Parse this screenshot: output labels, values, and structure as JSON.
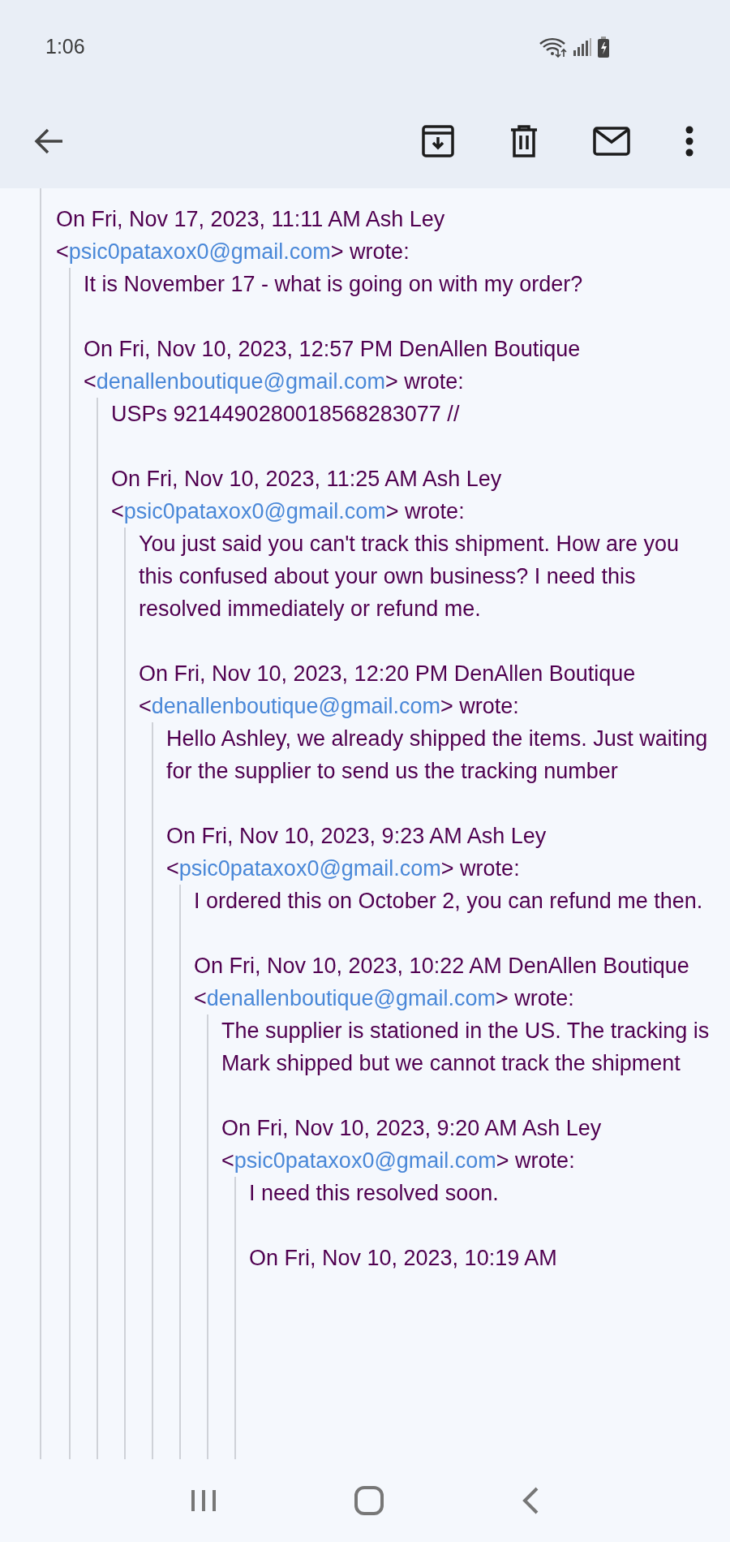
{
  "status_bar": {
    "time": "1:06"
  },
  "thread": [
    {
      "header": "On Fri, Nov 17, 2023, 11:11 AM Ash Ley <",
      "email": "psic0pataxox0@gmail.com",
      "suffix": "> wrote:",
      "body": "It is November 17 - what is going on with my order?",
      "children": [
        {
          "header": "On Fri, Nov 10, 2023, 12:57 PM DenAllen Boutique <",
          "email": "denallenboutique@gmail.com",
          "suffix": "> wrote:",
          "body": "USPs 9214490280018568283077 //",
          "children": [
            {
              "header": "On Fri, Nov 10, 2023, 11:25 AM Ash Ley <",
              "email": "psic0pataxox0@gmail.com",
              "suffix": "> wrote:",
              "body": "You just said you can't track this shipment. How are you this confused about your own business? I need this resolved immediately or refund me.",
              "children": [
                {
                  "header": "On Fri, Nov 10, 2023, 12:20 PM DenAllen Boutique <",
                  "email": "denallenboutique@gmail.com",
                  "suffix": "> wrote:",
                  "body": "Hello Ashley, we already shipped the items. Just waiting for the supplier to send us the tracking number",
                  "children": [
                    {
                      "header": "On Fri, Nov 10, 2023, 9:23 AM Ash Ley <",
                      "email": "psic0pataxox0@gmail.com",
                      "suffix": "> wrote:",
                      "body": "I ordered this on October 2, you can refund me then.",
                      "children": [
                        {
                          "header": "On Fri, Nov 10, 2023, 10:22 AM DenAllen Boutique <",
                          "email": "denallenboutique@gmail.com",
                          "suffix": "> wrote:",
                          "body": "The supplier is stationed in the US. The tracking is Mark shipped but we cannot track the shipment",
                          "children": [
                            {
                              "header": "On Fri, Nov 10, 2023, 9:20 AM Ash Ley <",
                              "email": "psic0pataxox0@gmail.com",
                              "suffix": "> wrote:",
                              "body": "I need this resolved soon.",
                              "children": [
                                {
                                  "header": "On Fri, Nov 10, 2023, 10:19 AM"
                                }
                              ]
                            }
                          ]
                        }
                      ]
                    }
                  ]
                }
              ]
            }
          ]
        }
      ]
    }
  ]
}
